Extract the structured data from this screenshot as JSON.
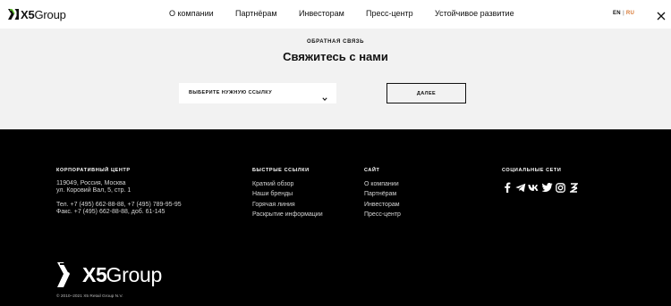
{
  "header": {
    "logo_text": "Group",
    "logo_x": "X5",
    "nav": [
      {
        "label": "О компании"
      },
      {
        "label": "Партнёрам"
      },
      {
        "label": "Инвесторам"
      },
      {
        "label": "Пресс-центр"
      },
      {
        "label": "Устойчивое развитие"
      }
    ],
    "lang_en": "EN",
    "lang_sep": "|",
    "lang_ru": "RU"
  },
  "contact": {
    "kicker": "ОБРАТНАЯ СВЯЗЬ",
    "title": "Свяжитесь с нами",
    "select_value": "ВЫБЕРИТЕ НУЖНУЮ ССЫЛКУ",
    "button_label": "ДАЛЕЕ"
  },
  "footer": {
    "corporate": {
      "title": "КОРПОРАТИВНЫЙ ЦЕНТР",
      "address_line1": "119049, Россия, Москва",
      "address_line2": "ул. Коровий Вал, 5, стр. 1",
      "phone": "Тел. +7 (495) 662-88-88, +7 (495) 789-95-95",
      "fax": "Факс. +7 (495) 662-88-88, доб. 61-145"
    },
    "quick_links": {
      "title": "БЫСТРЫЕ ССЫЛКИ",
      "items": [
        "Краткий обзор",
        "Наши бренды",
        "Горячая линия",
        "Раскрытие информации"
      ]
    },
    "site": {
      "title": "САЙТ",
      "items": [
        "О компании",
        "Партнёрам",
        "Инвесторам",
        "Пресс-центр"
      ]
    },
    "social": {
      "title": "СОЦИАЛЬНЫЕ СЕТИ",
      "icons": [
        "facebook-icon",
        "telegram-icon",
        "vk-icon",
        "twitter-icon",
        "instagram-icon",
        "zen-icon"
      ]
    },
    "logo_text": "Group",
    "logo_x": "X5",
    "copyright": "© 2010–2021 X5 Retail Group N.V."
  }
}
